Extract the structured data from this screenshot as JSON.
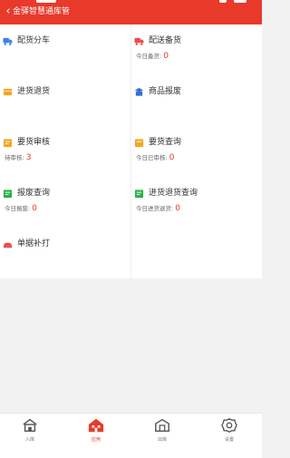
{
  "header": {
    "back_glyph": "‹",
    "title": "金驿智慧通库管"
  },
  "tiles": [
    {
      "label": "配货分车",
      "icon": "truck-icon",
      "color": "#3d7ef0"
    },
    {
      "label": "配送备货",
      "icon": "delivery-truck-icon",
      "color": "#f04a4a",
      "sub_label": "今日备货:",
      "sub_value": "0"
    },
    {
      "label": "进货退货",
      "icon": "box-icon",
      "color": "#f5a623"
    },
    {
      "label": "商品报废",
      "icon": "scrap-icon",
      "color": "#2f6fd6"
    },
    {
      "label": "要货审核",
      "icon": "review-icon",
      "color": "#f5a623",
      "sub_label": "待审核:",
      "sub_value": "3"
    },
    {
      "label": "要货查询",
      "icon": "query-icon",
      "color": "#f5a623",
      "sub_label": "今日已审核:",
      "sub_value": "0"
    },
    {
      "label": "报废查询",
      "icon": "scrap-query-icon",
      "color": "#2bb24c",
      "sub_label": "今日报废:",
      "sub_value": "0"
    },
    {
      "label": "进货退货查询",
      "icon": "return-query-icon",
      "color": "#2bb24c",
      "sub_label": "今日进货退货:",
      "sub_value": "0"
    },
    {
      "label": "单据补打",
      "icon": "printer-icon",
      "color": "#f04a4a"
    }
  ],
  "tabbar": {
    "tabs": [
      {
        "label": "入库",
        "icon": "warehouse-in-icon"
      },
      {
        "label": "应用",
        "icon": "apps-icon",
        "active": true
      },
      {
        "label": "出库",
        "icon": "warehouse-out-icon"
      },
      {
        "label": "设置",
        "icon": "settings-icon"
      }
    ]
  },
  "colors": {
    "header_bg": "#e8392b",
    "accent": "#e8392b",
    "page_bg": "#f2f2f2"
  }
}
